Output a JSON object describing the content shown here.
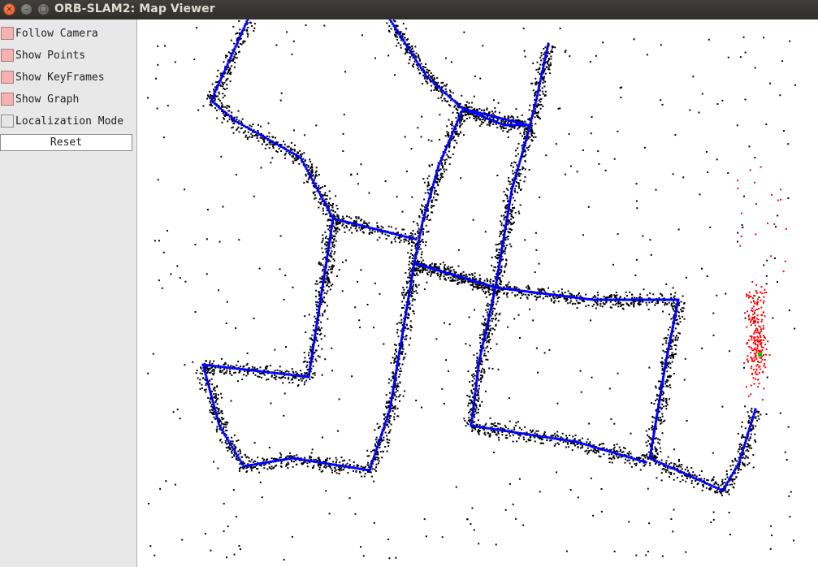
{
  "window": {
    "title": "ORB-SLAM2: Map Viewer",
    "close_glyph": "×",
    "min_glyph": "–",
    "max_glyph": "□"
  },
  "panel": {
    "options": [
      {
        "label": "Follow Camera",
        "checked": true
      },
      {
        "label": "Show Points",
        "checked": true
      },
      {
        "label": "Show KeyFrames",
        "checked": true
      },
      {
        "label": "Show Graph",
        "checked": true
      },
      {
        "label": "Localization Mode",
        "checked": false
      }
    ],
    "reset_label": "Reset"
  },
  "viewer": {
    "colors": {
      "map_points": "#000000",
      "local_points": "#ff0000",
      "keyframes": "#0000ff",
      "current_camera": "#00cc00",
      "background": "#ffffff",
      "checkbox_on": "#f6b1b1"
    }
  }
}
